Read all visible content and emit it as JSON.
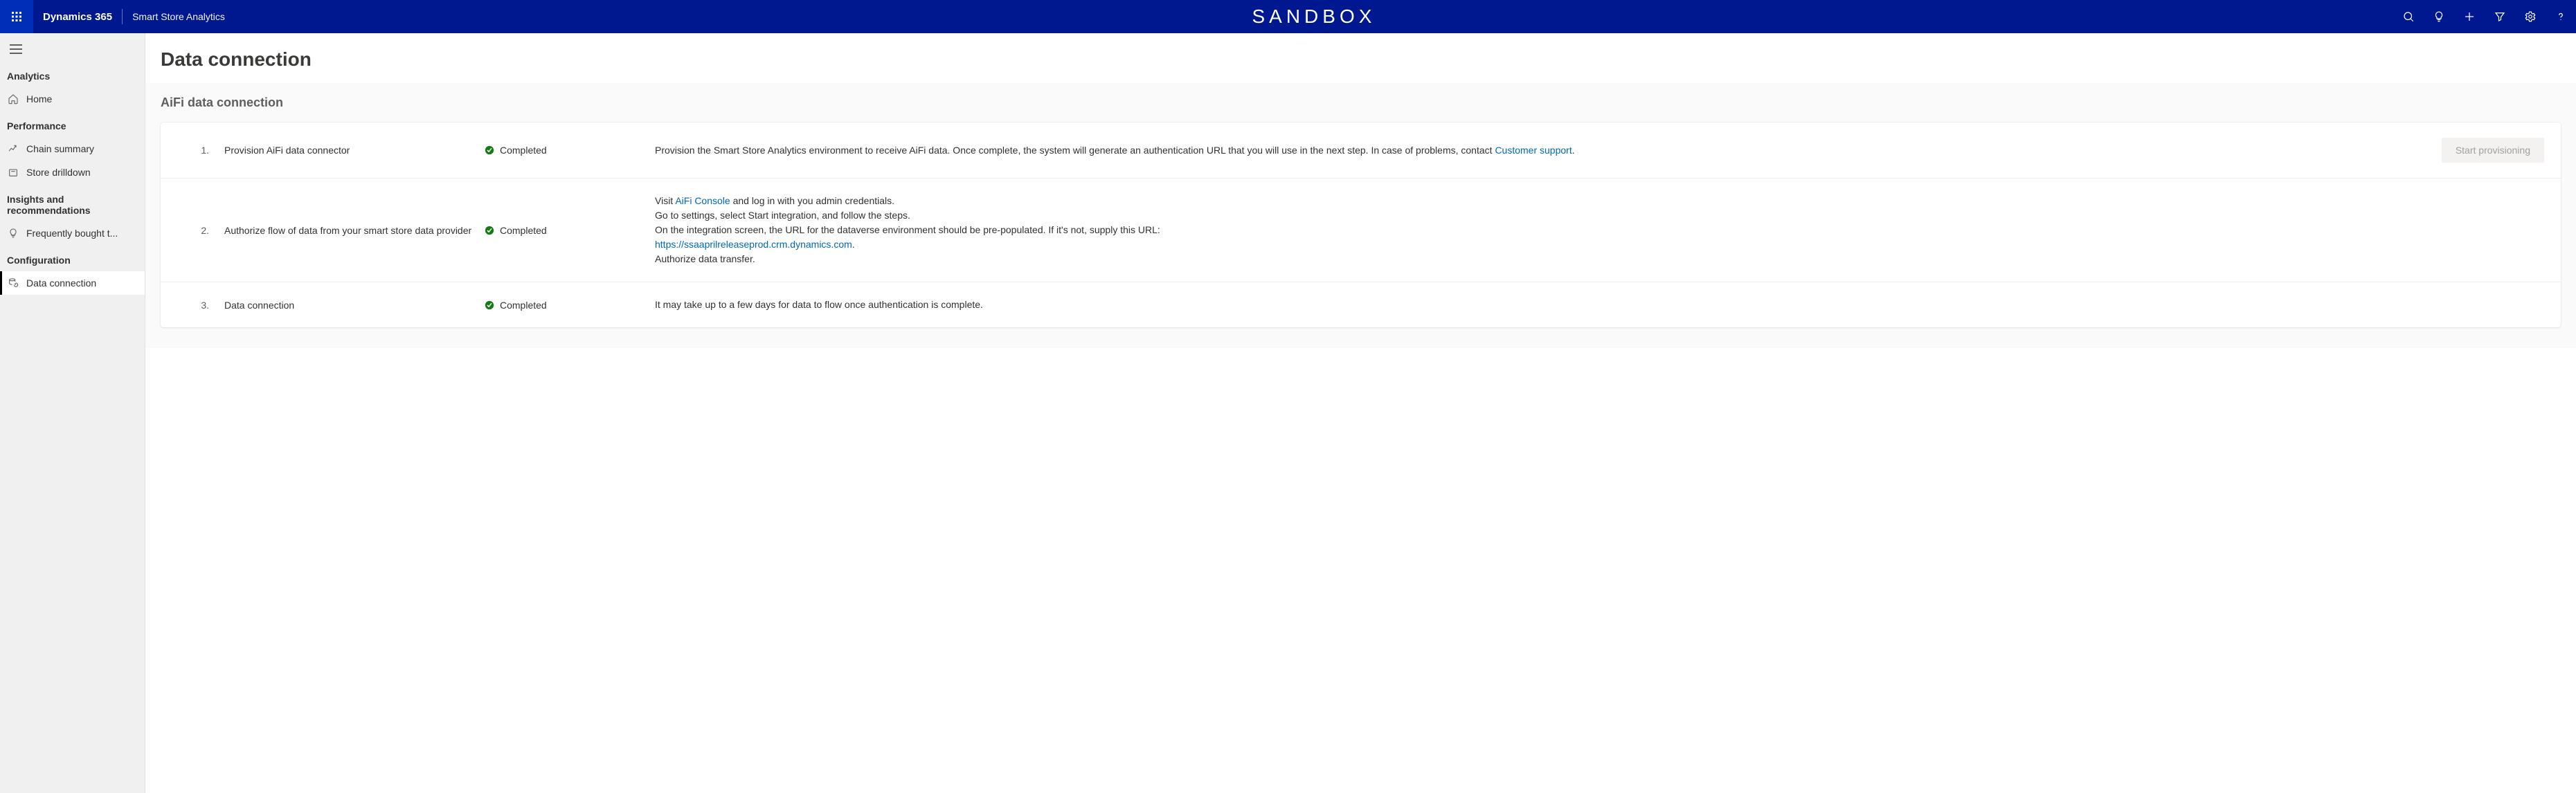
{
  "header": {
    "brand": "Dynamics 365",
    "app": "Smart Store Analytics",
    "sandbox": "SANDBOX"
  },
  "sidebar": {
    "groups": [
      {
        "title": "Analytics",
        "items": [
          {
            "label": "Home"
          }
        ]
      },
      {
        "title": "Performance",
        "items": [
          {
            "label": "Chain summary"
          },
          {
            "label": "Store drilldown"
          }
        ]
      },
      {
        "title": "Insights and recommendations",
        "items": [
          {
            "label": "Frequently bought t..."
          }
        ]
      },
      {
        "title": "Configuration",
        "items": [
          {
            "label": "Data connection"
          }
        ]
      }
    ]
  },
  "page": {
    "title": "Data connection",
    "section_title": "AiFi data connection"
  },
  "steps": [
    {
      "num": "1.",
      "title": "Provision AiFi data connector",
      "status": "Completed",
      "desc_prefix": "Provision the Smart Store Analytics environment to receive AiFi data. Once complete, the system will generate an authentication URL that you will use in the next step. In case of problems, contact ",
      "link_text": "Customer support",
      "desc_suffix": ".",
      "button": "Start provisioning"
    },
    {
      "num": "2.",
      "title": "Authorize flow of data from your smart store data provider",
      "status": "Completed",
      "line1_prefix": "Visit ",
      "line1_link": "AiFi Console",
      "line1_suffix": " and log in with you admin credentials.",
      "line2": "Go to settings, select Start integration, and follow the steps.",
      "line3": "On the integration screen, the URL for the dataverse environment should be pre-populated. If it's not, supply this URL:",
      "url": "https://ssaaprilreleaseprod.crm.dynamics.com",
      "url_suffix": ".",
      "line5": "Authorize data transfer."
    },
    {
      "num": "3.",
      "title": "Data connection",
      "status": "Completed",
      "desc": "It may take up to a few days for data to flow once authentication is complete."
    }
  ]
}
